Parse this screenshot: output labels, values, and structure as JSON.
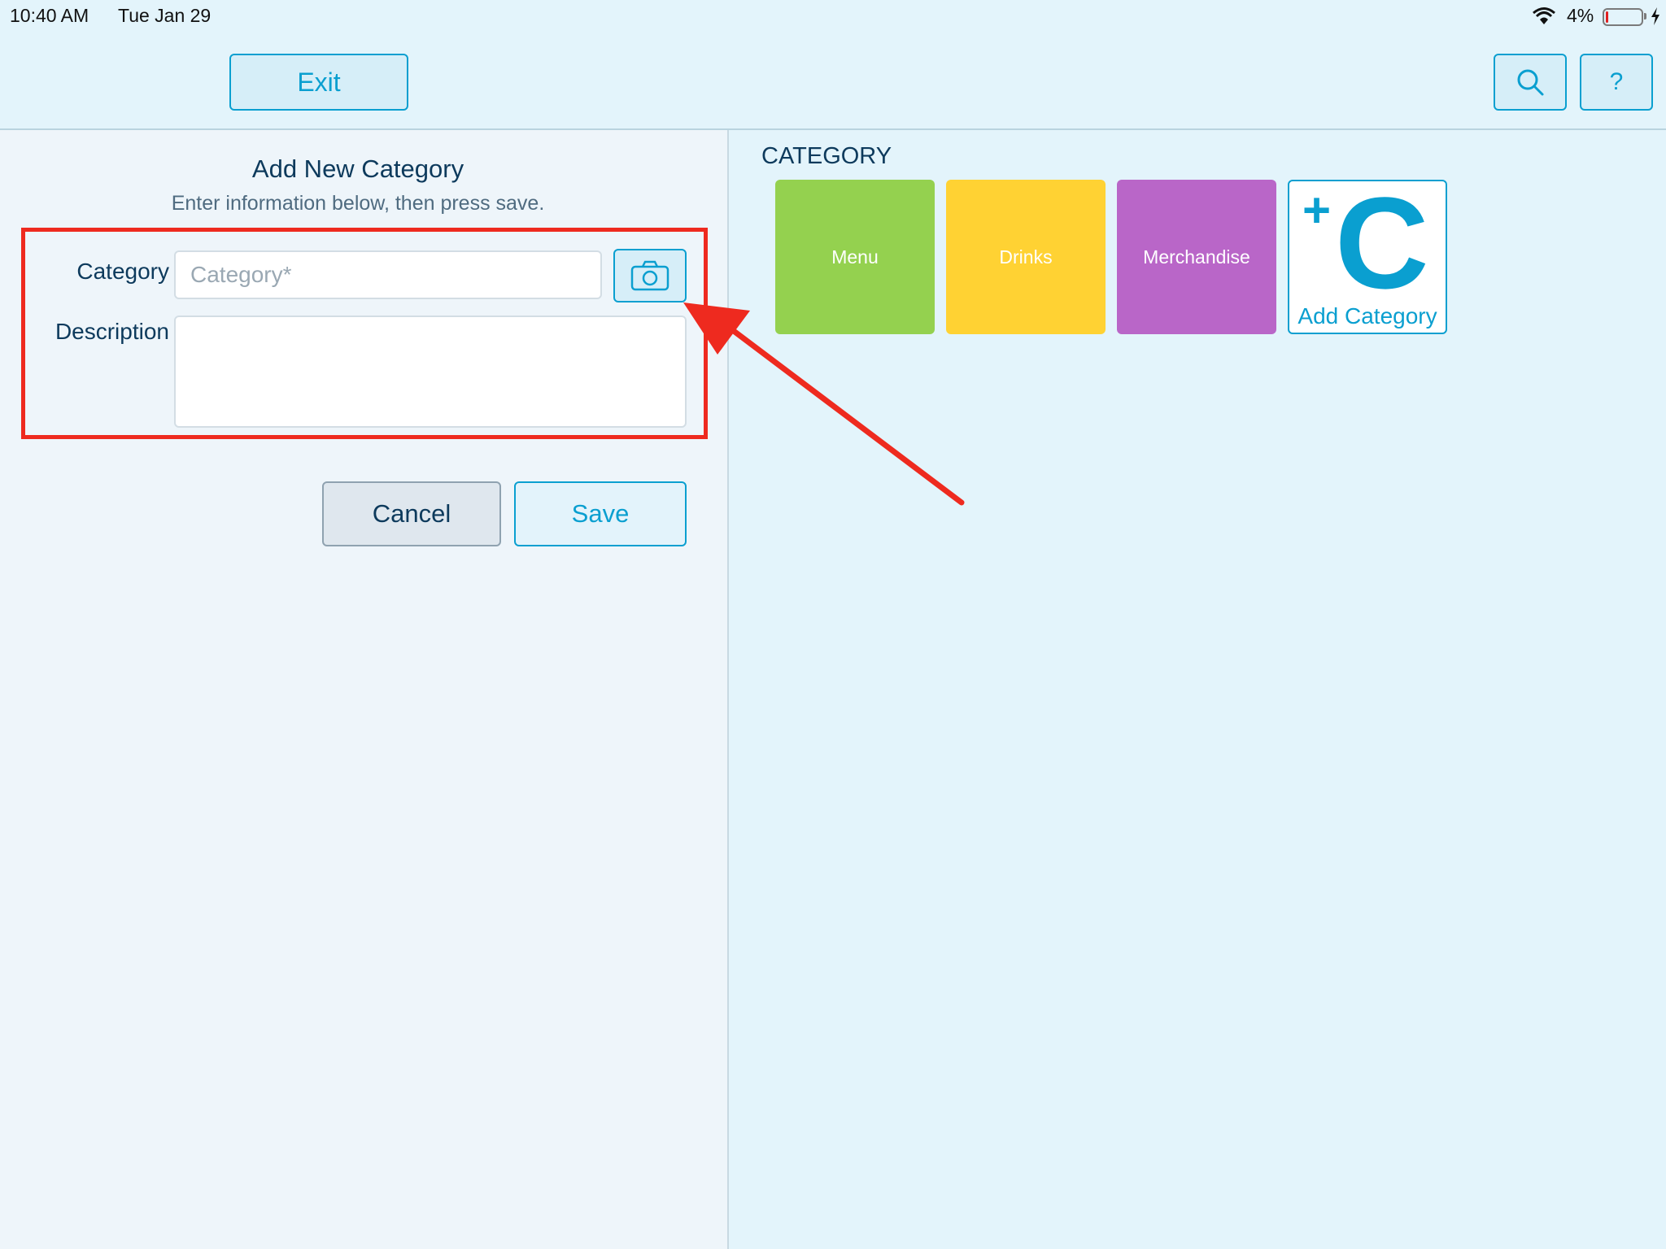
{
  "status_bar": {
    "time": "10:40 AM",
    "date": "Tue Jan 29",
    "battery": "4%"
  },
  "toolbar": {
    "exit_label": "Exit",
    "help_label": "?",
    "search_icon": "search-icon"
  },
  "form": {
    "title": "Add New Category",
    "subtitle": "Enter information below, then press save.",
    "category_label": "Category",
    "category_placeholder": "Category*",
    "category_value": "",
    "description_label": "Description",
    "description_value": "",
    "camera_icon": "camera-icon",
    "cancel_label": "Cancel",
    "save_label": "Save"
  },
  "categories": {
    "title": "CATEGORY",
    "tiles": [
      {
        "label": "Menu",
        "color": "#94d14f"
      },
      {
        "label": "Drinks",
        "color": "#ffd233"
      },
      {
        "label": "Merchandise",
        "color": "#b966c8"
      }
    ],
    "add_tile": {
      "plus": "+",
      "letter": "C",
      "label": "Add Category"
    }
  },
  "colors": {
    "accent": "#0a9fd0",
    "highlight": "#ee2a1f",
    "background": "#e3f4fb"
  }
}
